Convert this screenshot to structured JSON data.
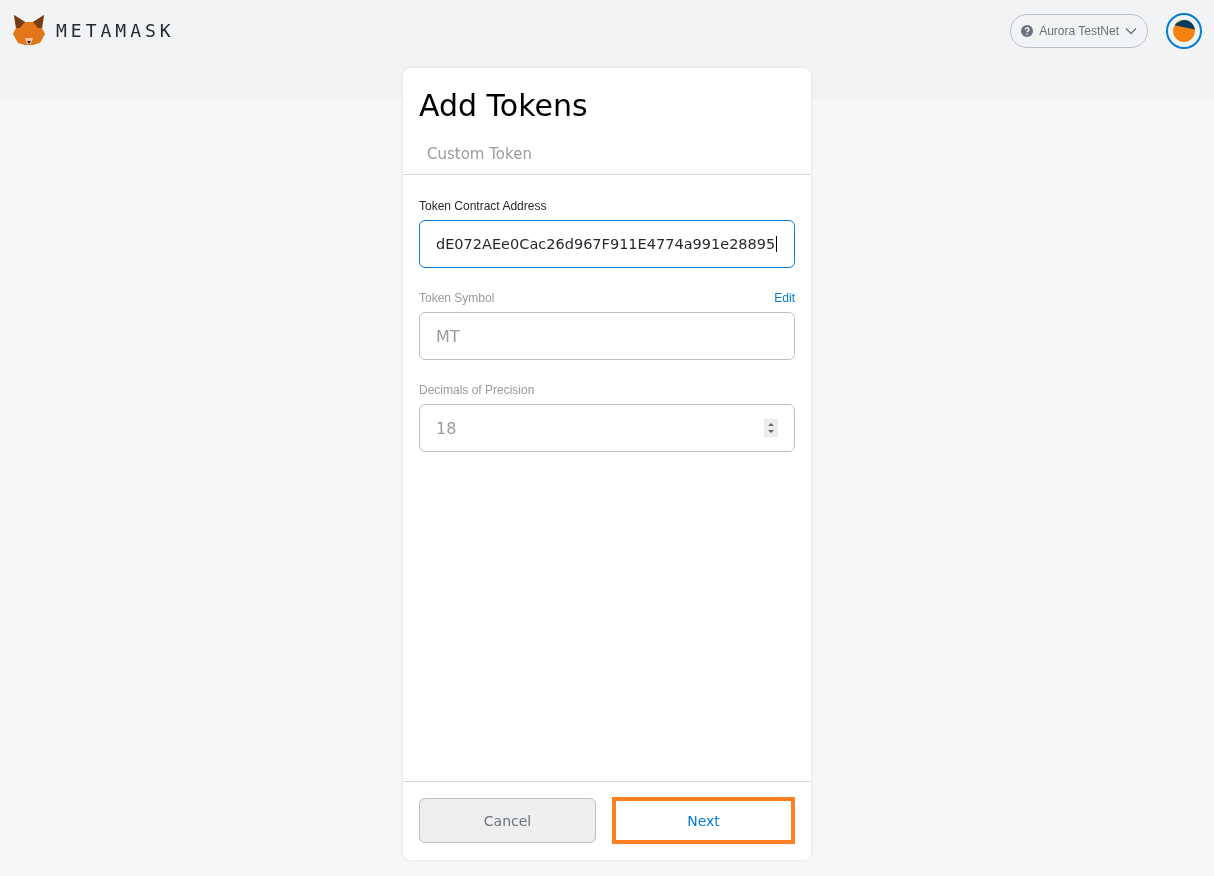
{
  "header": {
    "logo_text": "METAMASK",
    "network": "Aurora TestNet"
  },
  "card": {
    "title": "Add Tokens",
    "tabs": [
      {
        "label": "Custom Token",
        "selected": false
      }
    ],
    "fields": [
      {
        "kind": "text",
        "label": "Token Contract Address",
        "value": "dE072AEe0Cac26d967F911E4774a991e28895",
        "disabled": false,
        "focused": true
      },
      {
        "kind": "text",
        "label": "Token Symbol",
        "action": "Edit",
        "value": "MT",
        "disabled": true,
        "focused": false
      },
      {
        "kind": "number",
        "label": "Decimals of Precision",
        "value": "18",
        "disabled": true,
        "focused": false
      }
    ],
    "buttons": [
      {
        "label": "Cancel",
        "kind": "secondary",
        "highlighted": false
      },
      {
        "label": "Next",
        "kind": "primary",
        "highlighted": true
      }
    ]
  }
}
